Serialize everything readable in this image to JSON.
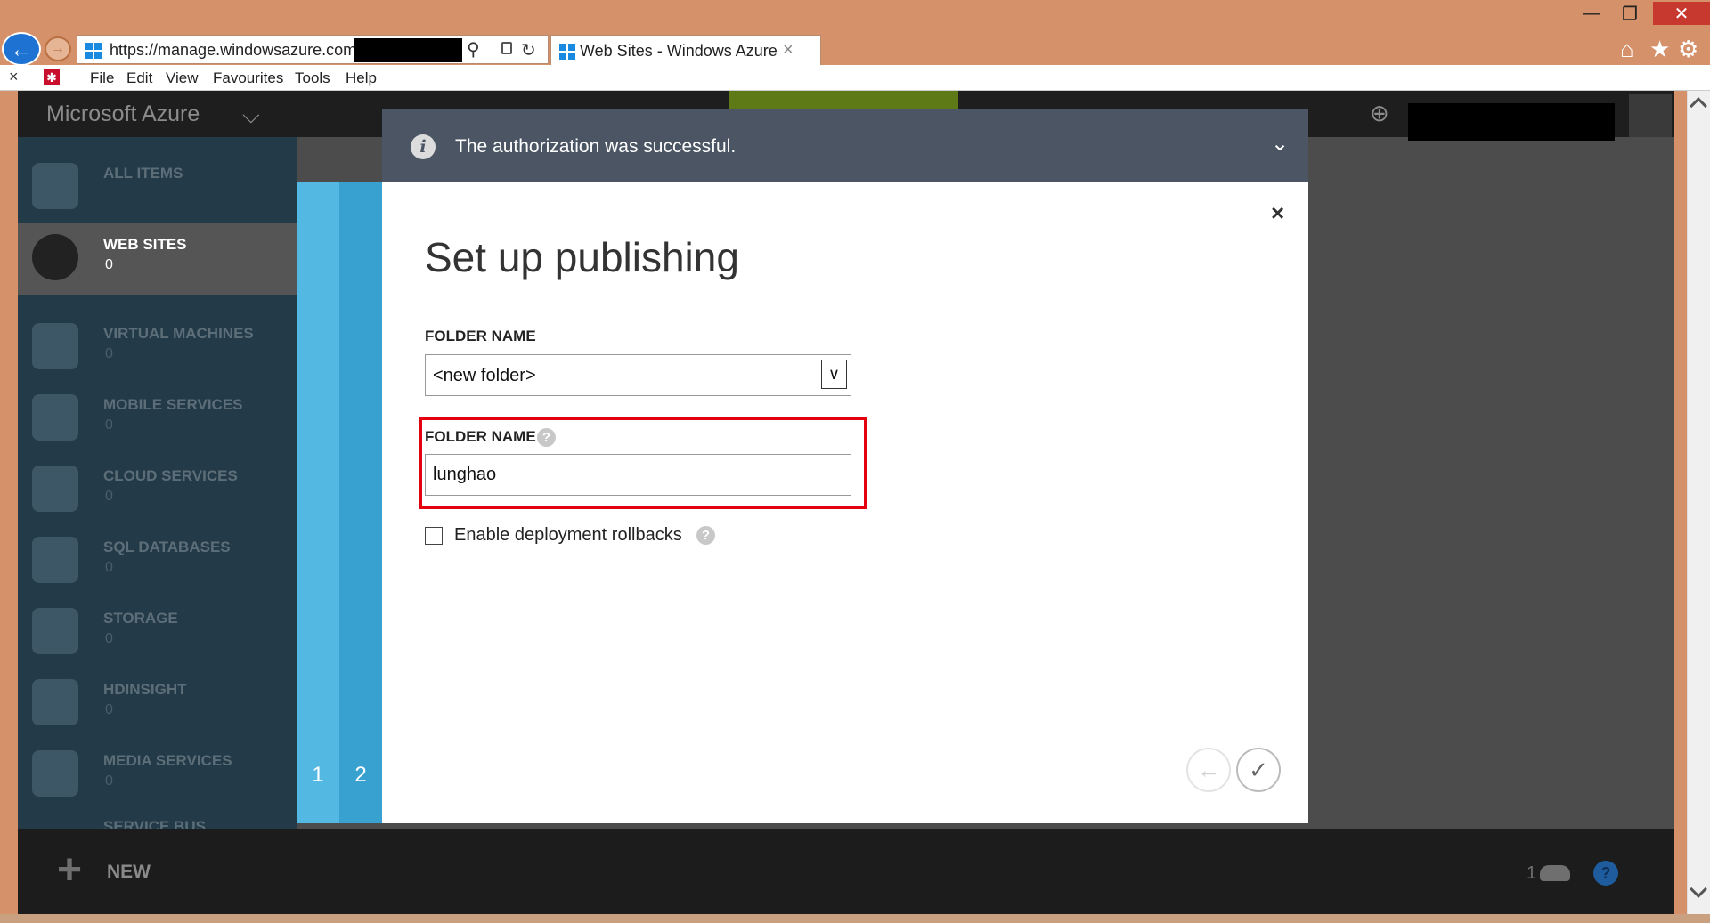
{
  "browser": {
    "url": "https://manage.windowsazure.com/",
    "tab_title": "Web Sites - Windows Azure",
    "tab_close": "×",
    "back_glyph": "←",
    "forward_glyph": "→",
    "search_glyph": "⚲",
    "refresh_glyph": "↻",
    "menu_close": "×",
    "menu": [
      "File",
      "Edit",
      "View",
      "Favourites",
      "Tools",
      "Help"
    ],
    "window_controls": {
      "minimize": "—",
      "restore": "❐",
      "close": "✕"
    },
    "toolbar_icons": {
      "home": "⌂",
      "favorites": "★",
      "tools": "⚙"
    }
  },
  "portal": {
    "brand": "Microsoft Azure",
    "brand_chevron": "⌵",
    "nav": [
      {
        "label": "ALL ITEMS",
        "count": ""
      },
      {
        "label": "WEB SITES",
        "count": "0"
      },
      {
        "label": "VIRTUAL MACHINES",
        "count": "0"
      },
      {
        "label": "MOBILE SERVICES",
        "count": "0"
      },
      {
        "label": "CLOUD SERVICES",
        "count": "0"
      },
      {
        "label": "SQL DATABASES",
        "count": "0"
      },
      {
        "label": "STORAGE",
        "count": "0"
      },
      {
        "label": "HDINSIGHT",
        "count": "0"
      },
      {
        "label": "MEDIA SERVICES",
        "count": "0"
      },
      {
        "label": "SERVICE BUS",
        "count": ""
      }
    ],
    "new_plus": "+",
    "new_label": "NEW",
    "cloud_count": "1",
    "help_glyph": "?",
    "globe_glyph": "⊕"
  },
  "notification": {
    "icon": "i",
    "text": "The authorization was successful.",
    "chevron": "⌄"
  },
  "dialog": {
    "title": "Set up publishing",
    "close": "×",
    "steps": [
      "1",
      "2"
    ],
    "folder_select_label": "FOLDER NAME",
    "folder_select_value": "<new folder>",
    "select_arrow": "∨",
    "folder_input_label": "FOLDER NAME",
    "folder_input_value": "lunghao",
    "help_glyph": "?",
    "rollback_label": "Enable deployment rollbacks",
    "prev_glyph": "←",
    "done_glyph": "✓"
  },
  "colors": {
    "accent": "#1e73d2",
    "highlight": "#e3000f",
    "step1": "#53b8e2",
    "step2": "#39a1cf"
  }
}
